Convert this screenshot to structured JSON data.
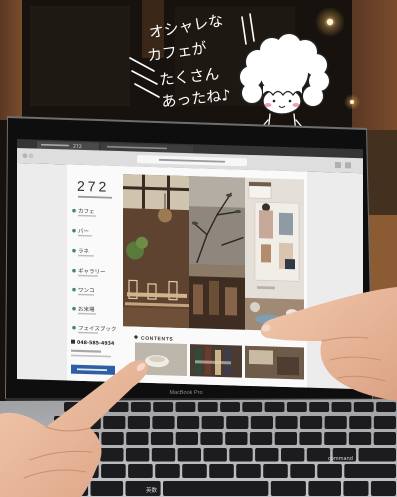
{
  "annotation": {
    "lines": [
      "オシャレな",
      "カフェが",
      "たくさん",
      "あったね♪"
    ]
  },
  "browser": {
    "tab_label": "272"
  },
  "website": {
    "logo": "272",
    "nav": [
      "カフェ",
      "バー",
      "ラネ",
      "ギャラリー",
      "ワンコ",
      "お米場",
      "フェイスブック"
    ],
    "phone": "048-585-4934",
    "contents_heading": "CONTENTS"
  },
  "laptop": {
    "model_label": "MacBook Pro"
  },
  "keyboard": {
    "key_eisu": "英数",
    "key_command": "command"
  },
  "icons": {
    "nav_bullet": "dot-icon",
    "phone": "phone-icon",
    "contents_marker": "diamond-icon"
  },
  "colors": {
    "nav_dot": "#3f8f5e",
    "annotation": "#ffffff",
    "cheek": "#f19cb4",
    "facebook_button": "#2d5fa6"
  }
}
